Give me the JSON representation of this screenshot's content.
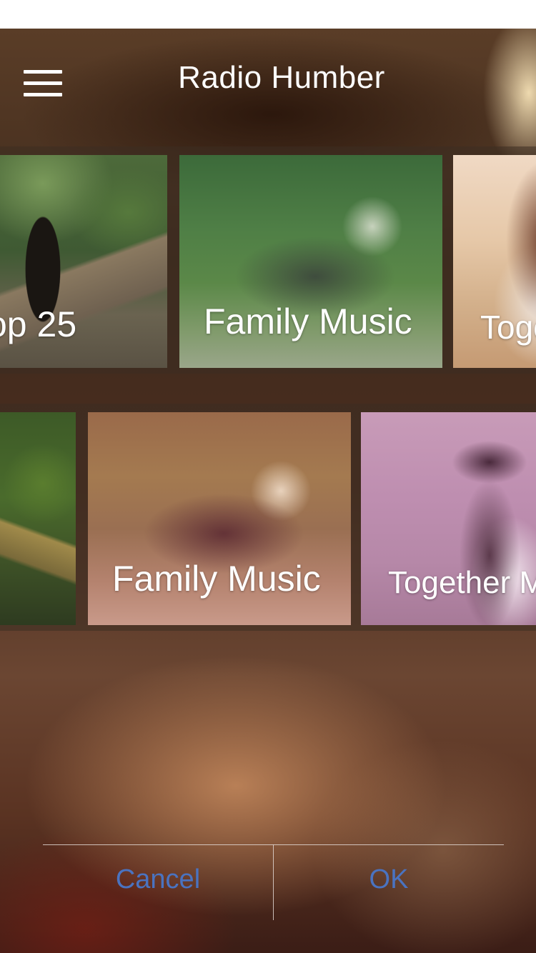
{
  "header": {
    "title": "Radio Humber",
    "menu_icon": "hamburger-menu-icon"
  },
  "rows": [
    {
      "cards": [
        {
          "label": "op 25"
        },
        {
          "label": "Family Music"
        },
        {
          "label": "Toge"
        }
      ]
    },
    {
      "cards": [
        {
          "label": ""
        },
        {
          "label": "Family Music"
        },
        {
          "label": "Together M"
        }
      ]
    }
  ],
  "dialog": {
    "cancel_label": "Cancel",
    "ok_label": "OK"
  },
  "colors": {
    "button_text": "#4a73c0",
    "title_text": "#ffffff"
  }
}
